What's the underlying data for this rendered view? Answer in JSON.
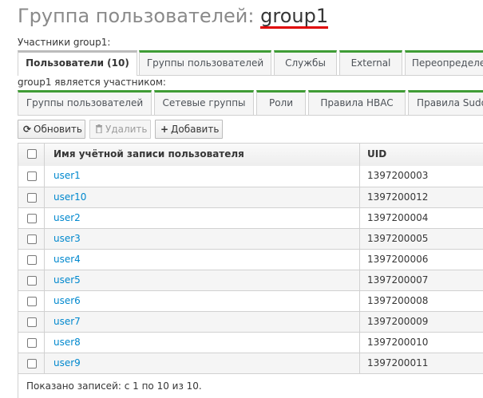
{
  "header": {
    "title_prefix": "Группа пользователей: ",
    "entity_name": "group1"
  },
  "members_section": {
    "label": "Участники group1:",
    "tabs": [
      {
        "label": "Пользователи (10)",
        "active": true
      },
      {
        "label": "Группы пользователей",
        "active": false
      },
      {
        "label": "Службы",
        "active": false
      },
      {
        "label": "External",
        "active": false
      },
      {
        "label": "Переопределе",
        "active": false
      }
    ]
  },
  "member_of_section": {
    "label": "group1 является участником:",
    "tabs": [
      {
        "label": "Группы пользователей"
      },
      {
        "label": "Сетевые группы"
      },
      {
        "label": "Роли"
      },
      {
        "label": "Правила HBAC"
      },
      {
        "label": "Правила Sudo"
      }
    ]
  },
  "toolbar": {
    "refresh_icon": "refresh-icon",
    "refresh_label": "Обновить",
    "delete_icon": "trash-icon",
    "delete_label": "Удалить",
    "add_icon": "plus-icon",
    "add_label": "Добавить"
  },
  "table": {
    "columns": [
      "Имя учётной записи пользователя",
      "UID"
    ],
    "rows": [
      {
        "name": "user1",
        "uid": "1397200003"
      },
      {
        "name": "user10",
        "uid": "1397200012"
      },
      {
        "name": "user2",
        "uid": "1397200004"
      },
      {
        "name": "user3",
        "uid": "1397200005"
      },
      {
        "name": "user4",
        "uid": "1397200006"
      },
      {
        "name": "user5",
        "uid": "1397200007"
      },
      {
        "name": "user6",
        "uid": "1397200008"
      },
      {
        "name": "user7",
        "uid": "1397200009"
      },
      {
        "name": "user8",
        "uid": "1397200010"
      },
      {
        "name": "user9",
        "uid": "1397200011"
      }
    ],
    "footer": "Показано записей: с 1 по 10 из 10."
  },
  "colors": {
    "accent_green": "#3f9c35",
    "link_blue": "#0088ce",
    "underline_red": "#e00000"
  }
}
